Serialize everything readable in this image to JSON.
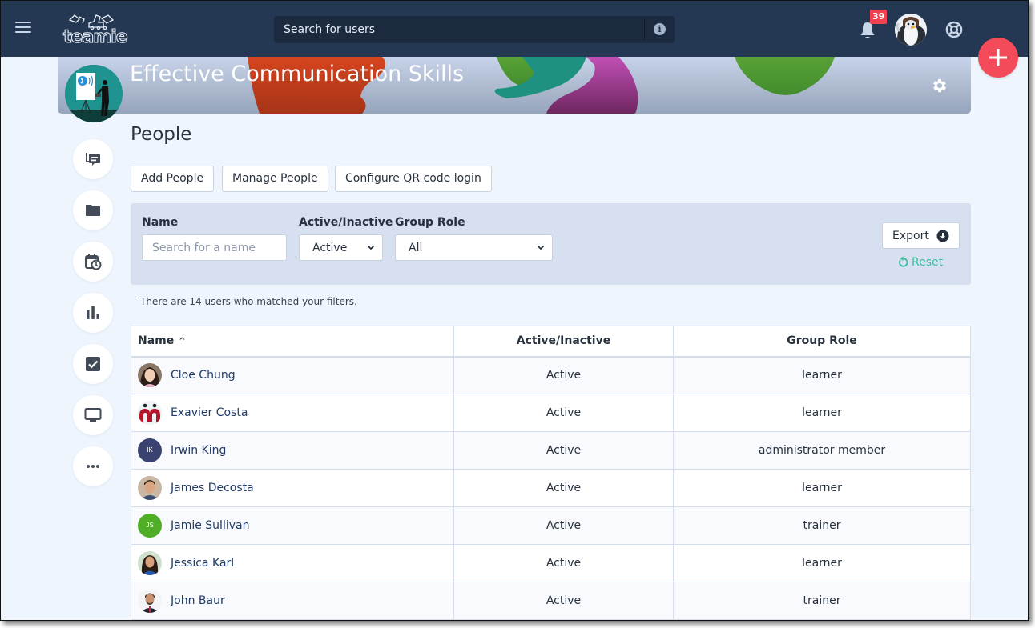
{
  "app": {
    "brand": "teamie",
    "colors": {
      "navbar": "#243854",
      "accent_fab": "#f34b59",
      "badge": "#f0414f",
      "reset_link": "#3bbf9c",
      "page_bg": "#eef5fd",
      "filter_bg": "#d6e0f1"
    }
  },
  "navbar": {
    "menu_icon": "hamburger-icon",
    "search_placeholder": "Search for users",
    "search_info_icon": "info-icon",
    "notifications_icon": "bell-icon",
    "notifications_count": "39",
    "help_icon": "lifebuoy-icon",
    "fab_icon": "plus-icon"
  },
  "banner": {
    "title": "Effective Communication Skills",
    "settings_icon": "gear-icon"
  },
  "rail": [
    {
      "name": "discussion",
      "icon": "chat-icon"
    },
    {
      "name": "files",
      "icon": "folder-icon"
    },
    {
      "name": "schedule",
      "icon": "calendar-clock-icon"
    },
    {
      "name": "analytics",
      "icon": "bar-chart-icon"
    },
    {
      "name": "tasks",
      "icon": "checkbox-icon"
    },
    {
      "name": "presentation",
      "icon": "monitor-icon"
    },
    {
      "name": "more",
      "icon": "more-horizontal-icon"
    }
  ],
  "page": {
    "title": "People",
    "actions": {
      "add_people": "Add People",
      "manage_people": "Manage People",
      "configure_qr": "Configure QR code login"
    }
  },
  "filters": {
    "name_label": "Name",
    "name_placeholder": "Search for a name",
    "name_value": "",
    "status_label": "Active/Inactive",
    "status_value": "Active",
    "role_label": "Group Role",
    "role_value": "All",
    "export_label": "Export",
    "reset_label": "Reset"
  },
  "results": {
    "summary": "There are 14 users who matched your filters."
  },
  "table": {
    "columns": {
      "name": "Name",
      "status": "Active/Inactive",
      "role": "Group Role"
    },
    "sort": {
      "column": "name",
      "direction": "ascending"
    },
    "rows": [
      {
        "name": "Cloe Chung",
        "status": "Active",
        "role": "learner",
        "avatar": "photo",
        "initials": ""
      },
      {
        "name": "Exavier Costa",
        "status": "Active",
        "role": "learner",
        "avatar": "logo",
        "initials": ""
      },
      {
        "name": "Irwin King",
        "status": "Active",
        "role": "administrator member",
        "avatar": "initials",
        "initials": "IK",
        "avatar_color": "#3a426f"
      },
      {
        "name": "James Decosta",
        "status": "Active",
        "role": "learner",
        "avatar": "photo",
        "initials": ""
      },
      {
        "name": "Jamie Sullivan",
        "status": "Active",
        "role": "trainer",
        "avatar": "initials",
        "initials": "JS",
        "avatar_color": "#4fae25"
      },
      {
        "name": "Jessica Karl",
        "status": "Active",
        "role": "learner",
        "avatar": "photo",
        "initials": ""
      },
      {
        "name": "John Baur",
        "status": "Active",
        "role": "trainer",
        "avatar": "photo",
        "initials": ""
      }
    ]
  }
}
